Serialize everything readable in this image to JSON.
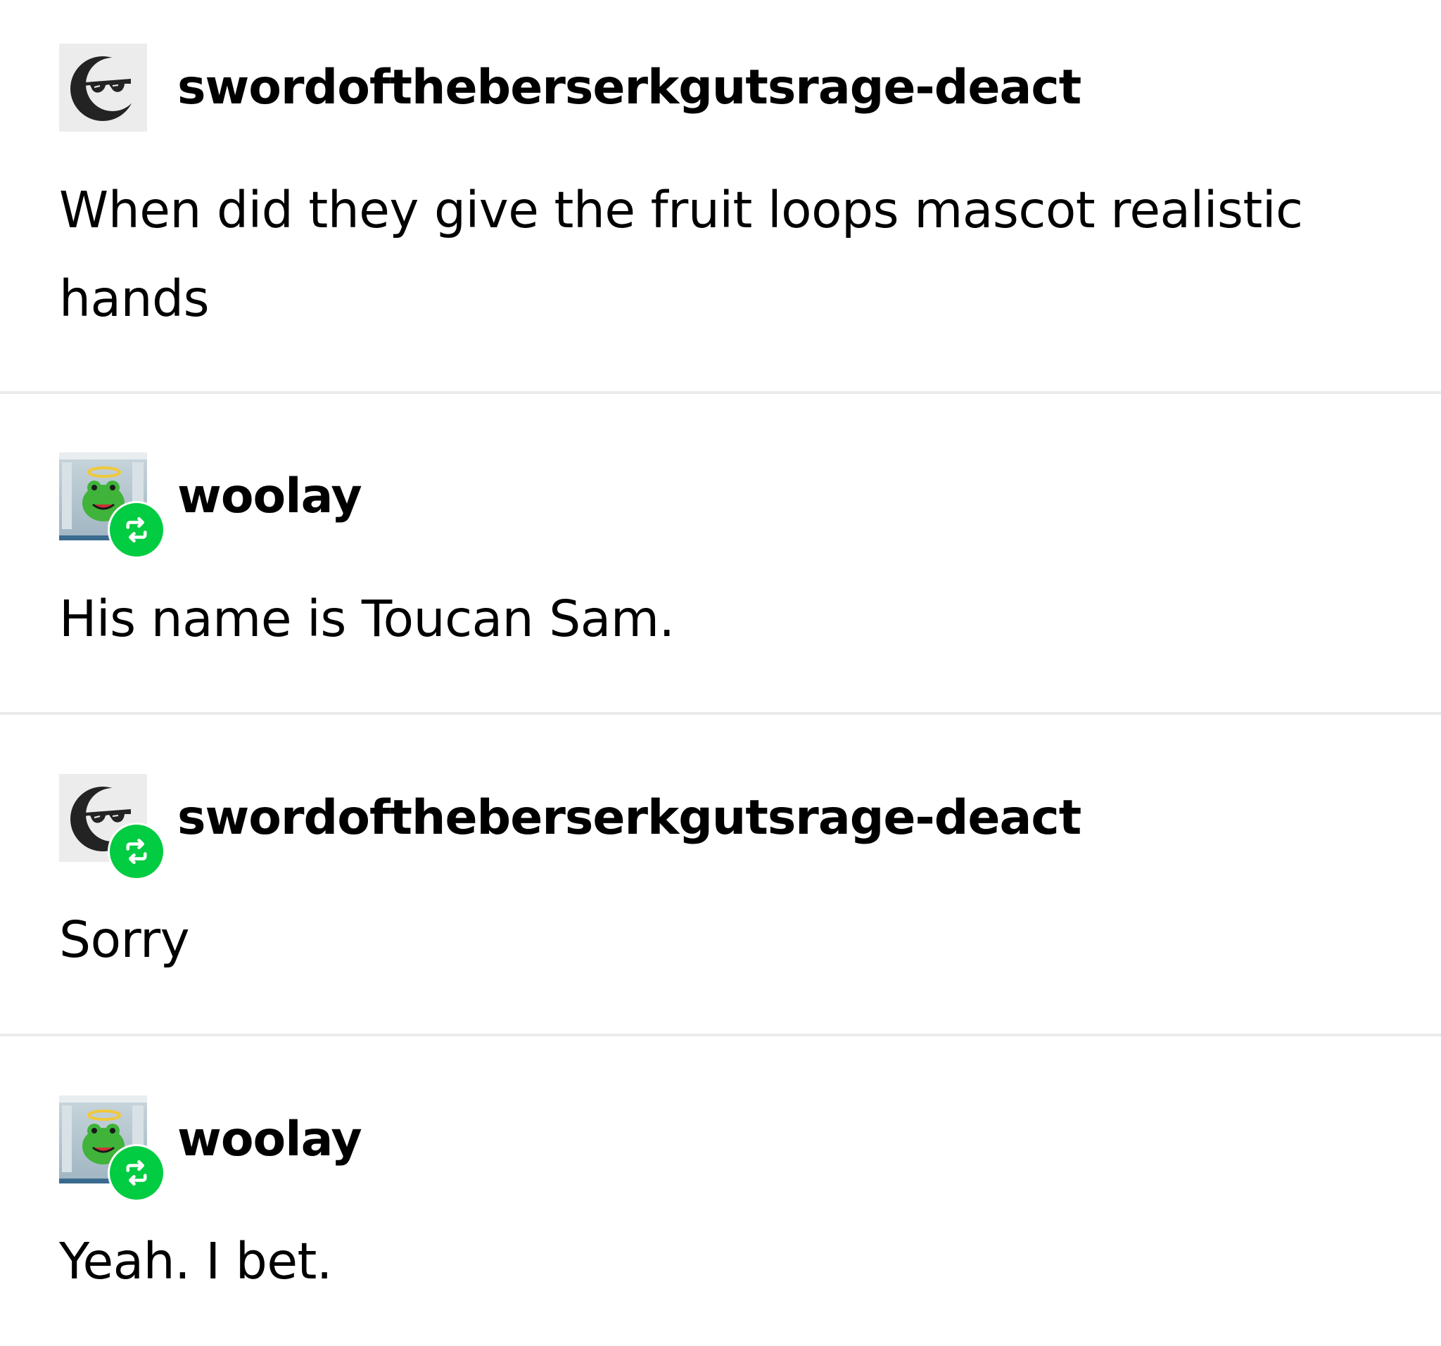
{
  "colors": {
    "reblog_badge": "#02cc42",
    "divider": "#ebebeb",
    "text": "#000000",
    "background": "#ffffff"
  },
  "posts": [
    {
      "username": "swordoftheberserkgutsrage-deact",
      "avatar": "sunglasses-moon-icon",
      "reblog": false,
      "text": "When did they give the fruit loops mascot realistic hands"
    },
    {
      "username": "woolay",
      "avatar": "frog-angel-avatar",
      "reblog": true,
      "text": "His name is Toucan Sam."
    },
    {
      "username": "swordoftheberserkgutsrage-deact",
      "avatar": "sunglasses-moon-icon",
      "reblog": true,
      "text": "Sorry"
    },
    {
      "username": "woolay",
      "avatar": "frog-angel-avatar",
      "reblog": true,
      "text": "Yeah. I bet."
    }
  ]
}
